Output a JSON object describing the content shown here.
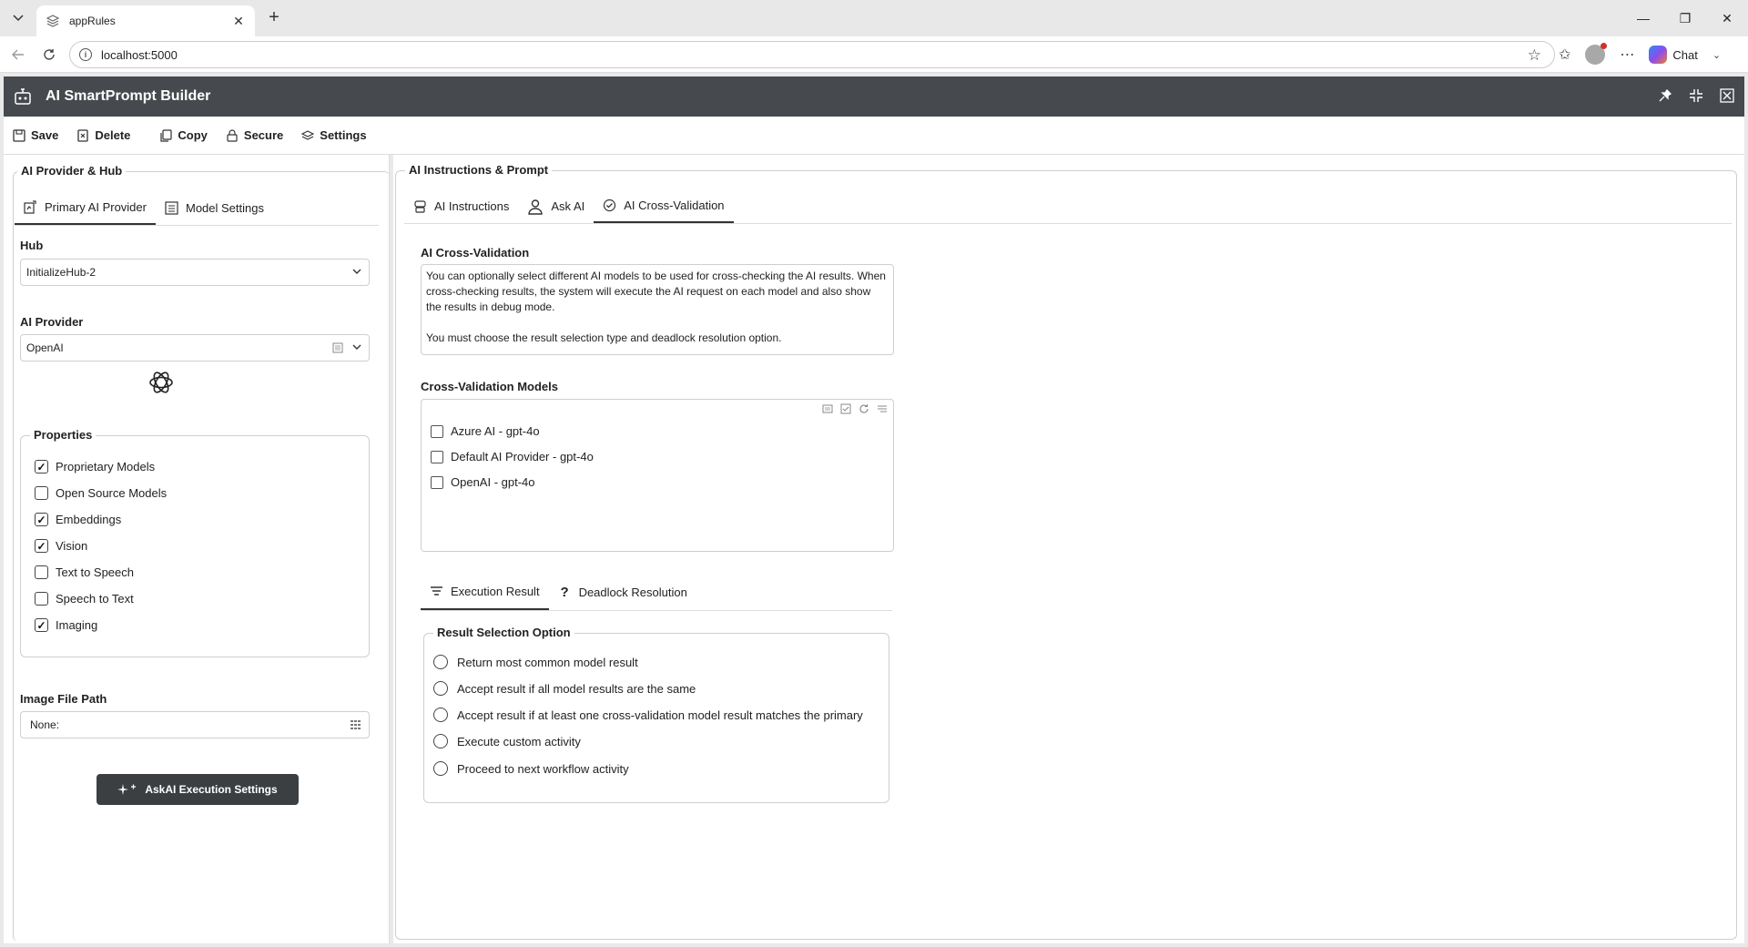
{
  "browser": {
    "tab_title": "appRules",
    "url": "localhost:5000",
    "chat_label": "Chat"
  },
  "app": {
    "title": "AI SmartPrompt Builder"
  },
  "toolbar": {
    "save": "Save",
    "delete": "Delete",
    "copy": "Copy",
    "secure": "Secure",
    "settings": "Settings"
  },
  "left": {
    "section_title": "AI Provider & Hub",
    "tabs": [
      {
        "label": "Primary AI Provider",
        "active": true
      },
      {
        "label": "Model Settings",
        "active": false
      }
    ],
    "hub_label": "Hub",
    "hub_value": "InitializeHub-2",
    "provider_label": "AI Provider",
    "provider_value": "OpenAI",
    "properties_title": "Properties",
    "properties": [
      {
        "label": "Proprietary Models",
        "checked": true
      },
      {
        "label": "Open Source Models",
        "checked": false
      },
      {
        "label": "Embeddings",
        "checked": true
      },
      {
        "label": "Vision",
        "checked": true
      },
      {
        "label": "Text to Speech",
        "checked": false
      },
      {
        "label": "Speech to Text",
        "checked": false
      },
      {
        "label": "Imaging",
        "checked": true
      }
    ],
    "image_path_label": "Image File Path",
    "image_path_value": "None:",
    "exec_button": "AskAI Execution Settings"
  },
  "right": {
    "section_title": "AI Instructions & Prompt",
    "tabs": [
      {
        "label": "AI Instructions",
        "active": false
      },
      {
        "label": "Ask AI",
        "active": false
      },
      {
        "label": "AI Cross-Validation",
        "active": true
      }
    ],
    "cv_title": "AI Cross-Validation",
    "cv_desc_1": "You can optionally select different AI models to be used for cross-checking the AI results. When cross-checking results, the system will execute the AI request on each model and also show the results in debug mode.",
    "cv_desc_2": "You must choose the result selection type and deadlock resolution option.",
    "models_title": "Cross-Validation Models",
    "models": [
      {
        "label": "Azure AI - gpt-4o",
        "checked": false
      },
      {
        "label": "Default AI Provider - gpt-4o",
        "checked": false
      },
      {
        "label": "OpenAI - gpt-4o",
        "checked": false
      }
    ],
    "sub_tabs": [
      {
        "label": "Execution Result",
        "active": true
      },
      {
        "label": "Deadlock Resolution",
        "active": false
      }
    ],
    "result_title": "Result Selection Option",
    "result_options": [
      "Return most common model result",
      "Accept result if all model results are the same",
      "Accept result if at least one cross-validation model result matches the primary",
      "Execute custom activity",
      "Proceed to next workflow activity"
    ]
  }
}
